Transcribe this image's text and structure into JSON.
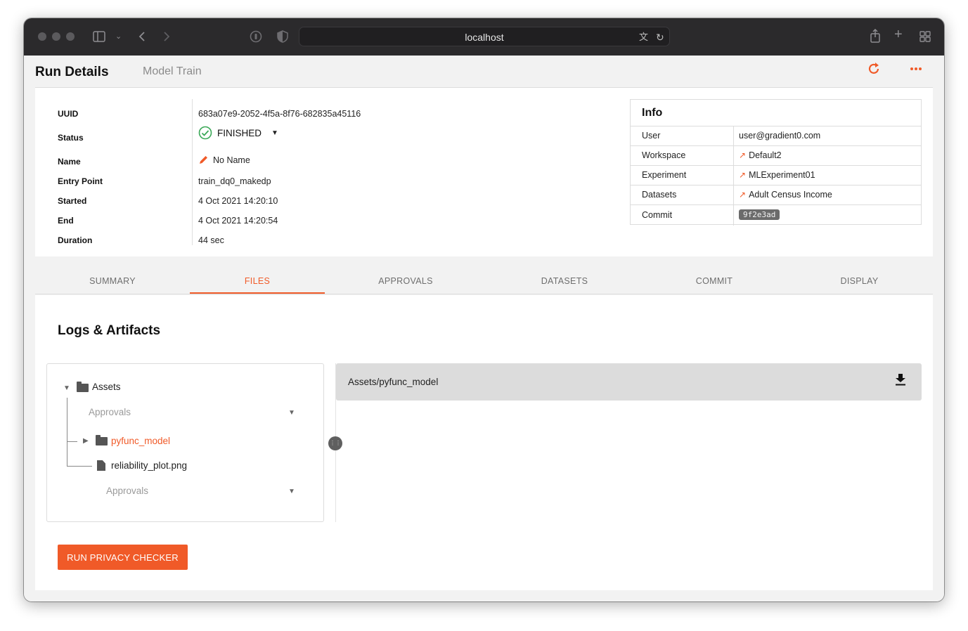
{
  "browser": {
    "url": "localhost"
  },
  "header": {
    "title": "Run Details",
    "subtitle": "Model Train"
  },
  "details": {
    "rows": [
      {
        "label": "UUID",
        "value": "683a07e9-2052-4f5a-8f76-682835a45116"
      },
      {
        "label": "Status",
        "value": "FINISHED"
      },
      {
        "label": "Name",
        "value": "No Name"
      },
      {
        "label": "Entry Point",
        "value": "train_dq0_makedp"
      },
      {
        "label": "Started",
        "value": "4 Oct 2021 14:20:10"
      },
      {
        "label": "End",
        "value": "4 Oct 2021 14:20:54"
      },
      {
        "label": "Duration",
        "value": "44 sec"
      }
    ]
  },
  "info": {
    "title": "Info",
    "rows": [
      {
        "key": "User",
        "value": "user@gradient0.com"
      },
      {
        "key": "Workspace",
        "value": "Default2"
      },
      {
        "key": "Experiment",
        "value": "MLExperiment01"
      },
      {
        "key": "Datasets",
        "value": "Adult Census Income"
      },
      {
        "key": "Commit",
        "value": "9f2e3ad"
      }
    ]
  },
  "tabs": [
    {
      "label": "SUMMARY",
      "active": false
    },
    {
      "label": "FILES",
      "active": true
    },
    {
      "label": "APPROVALS",
      "active": false
    },
    {
      "label": "DATASETS",
      "active": false
    },
    {
      "label": "COMMIT",
      "active": false
    },
    {
      "label": "DISPLAY",
      "active": false
    }
  ],
  "files": {
    "title": "Logs & Artifacts",
    "tree": {
      "root": "Assets",
      "root_select": "Approvals",
      "folder": "pyfunc_model",
      "file": "reliability_plot.png",
      "file_select": "Approvals"
    },
    "preview_path": "Assets/pyfunc_model",
    "run_button": "RUN PRIVACY CHECKER"
  },
  "colors": {
    "accent": "#f05a28",
    "success": "#3aa857"
  }
}
